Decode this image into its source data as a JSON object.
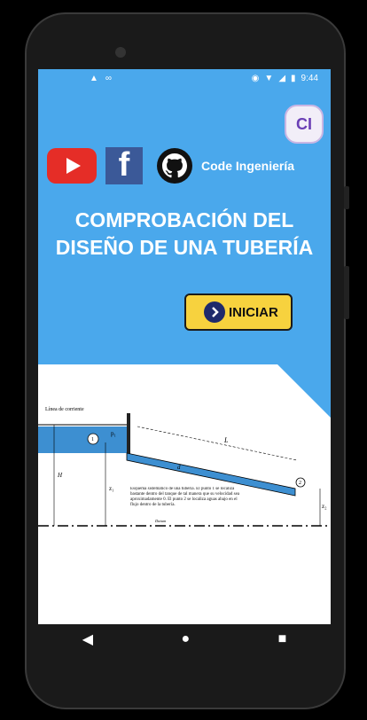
{
  "status": {
    "time": "9:44"
  },
  "badge": {
    "label": "CI"
  },
  "social": {
    "brand": "Code Ingeniería"
  },
  "main": {
    "title_line1": "COMPROBACIÓN DEL",
    "title_line2": "DISEÑO DE UNA TUBERÍA",
    "start_label": "INICIAR"
  },
  "diagram": {
    "label_streamline": "Línea de corriente",
    "label_L": "L",
    "label_H": "H",
    "label_z1": "z₁",
    "label_z2": "z₂",
    "label_p1": "p₁",
    "label_1": "1",
    "label_2": "2",
    "label_d": "d",
    "caption": "Esquema sistemático de una tubería. El punto 1 se localiza bastante dentro del tanque de tal manera que su velocidad sea aproximadamente 0. El punto 2 se localiza aguas abajo en el flujo dentro de la tubería.",
    "datum": "Datum"
  },
  "nav": {
    "back": "◀",
    "home": "●",
    "recent": "■"
  }
}
